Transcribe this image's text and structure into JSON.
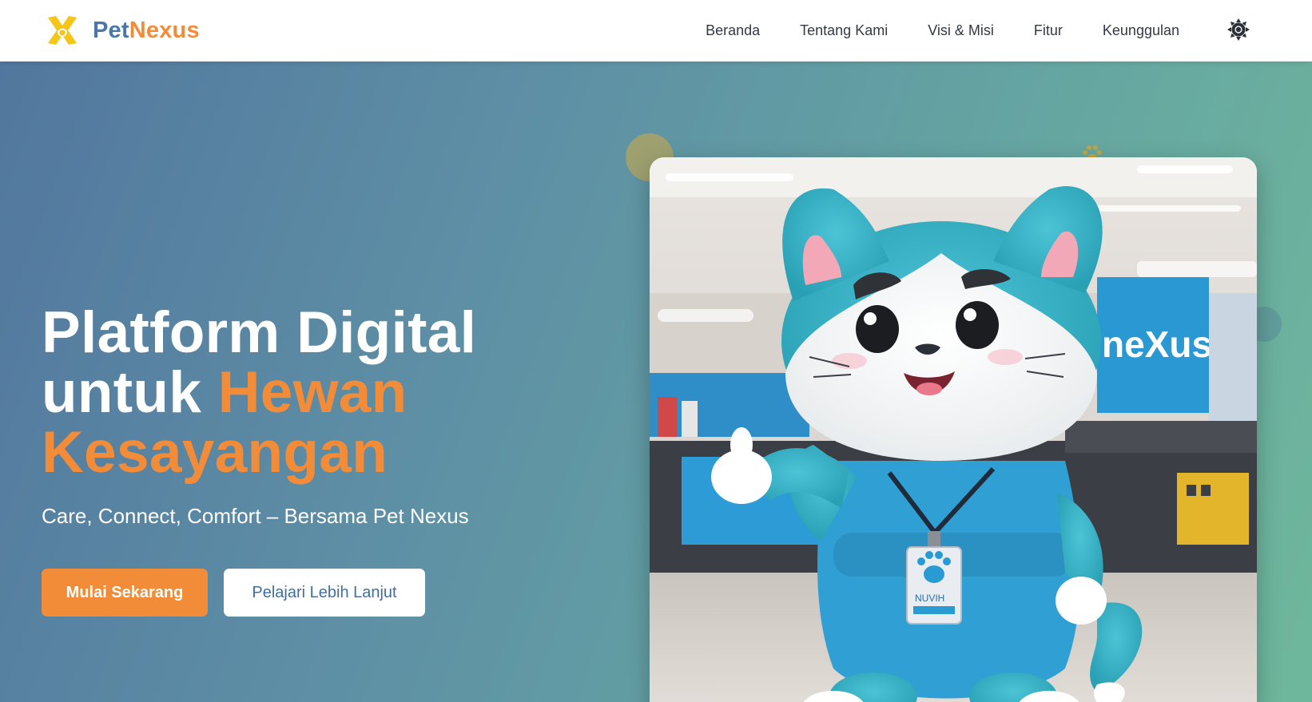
{
  "brand": {
    "name_part1": "Pet",
    "name_part2": "Nexus"
  },
  "nav": {
    "items": [
      "Beranda",
      "Tentang Kami",
      "Visi & Misi",
      "Fitur",
      "Keunggulan"
    ]
  },
  "theme_toggle": {
    "icon": "sun-icon"
  },
  "hero": {
    "title_line1": "Platform Digital",
    "title_line2_plain": "untuk",
    "title_line2_accent": "Hewan",
    "title_line3_accent": "Kesayangan",
    "subtitle": "Care, Connect, Comfort – Bersama Pet Nexus",
    "primary_button": "Mulai Sekarang",
    "secondary_button": "Pelajari Lebih Lanjut"
  },
  "mascot": {
    "store_sign_text": "neXus",
    "badge_text": "NUVIH"
  },
  "colors": {
    "brand_blue": "#4a76a8",
    "brand_orange": "#f28c38",
    "hero_gradient_start": "#52779e",
    "hero_gradient_end": "#6fb79c",
    "text_dark": "#333a45"
  }
}
